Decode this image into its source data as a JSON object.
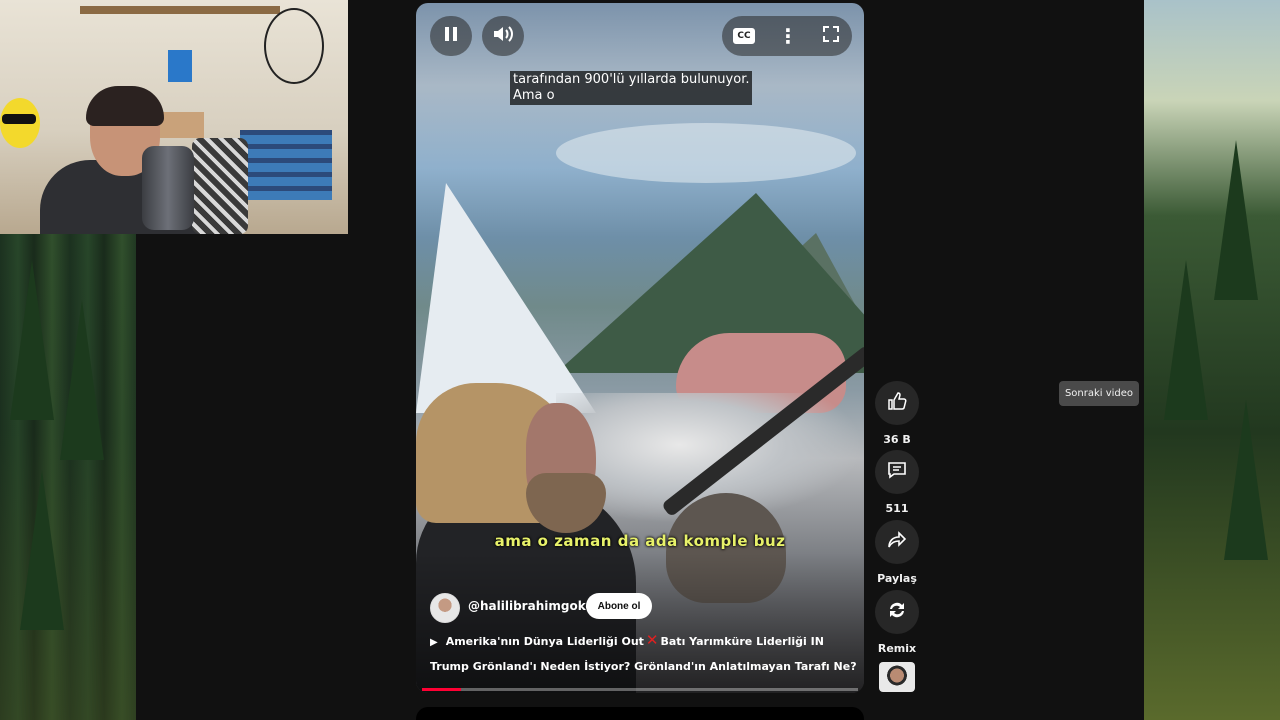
{
  "player": {
    "caption_lines": [
      "tarafından 900'lü yıllarda bulunuyor.",
      "Ama o"
    ],
    "burned_subtitle": "ama o zaman da ada komple buz",
    "progress": 0.09
  },
  "channel": {
    "handle": "@halilibrahimgoker",
    "subscribe_label": "Abone ol"
  },
  "playlist_line": {
    "part1": "Amerika'nın Dünya Liderliği Out",
    "part2": "Batı Yarımküre Liderliği IN"
  },
  "video": {
    "title": "Trump Grönland'ı Neden İstiyor? Grönland'ın Anlatılmayan Tarafı Ne?"
  },
  "actions": {
    "like_count": "36 B",
    "comment_count": "511",
    "share_label": "Paylaş",
    "remix_label": "Remix"
  },
  "tooltip": {
    "next_video": "Sonraki video"
  },
  "icons": {
    "pause": "pause-icon",
    "volume": "volume-icon",
    "cc": "cc-icon",
    "more": "more-vert-icon",
    "fullscreen": "fullscreen-icon",
    "like": "thumbs-up-icon",
    "comment": "comment-icon",
    "share": "share-icon",
    "remix": "remix-icon"
  },
  "colors": {
    "accent": "#ff0033",
    "subtitle": "#e8f26a",
    "background": "#0f0f0f"
  }
}
